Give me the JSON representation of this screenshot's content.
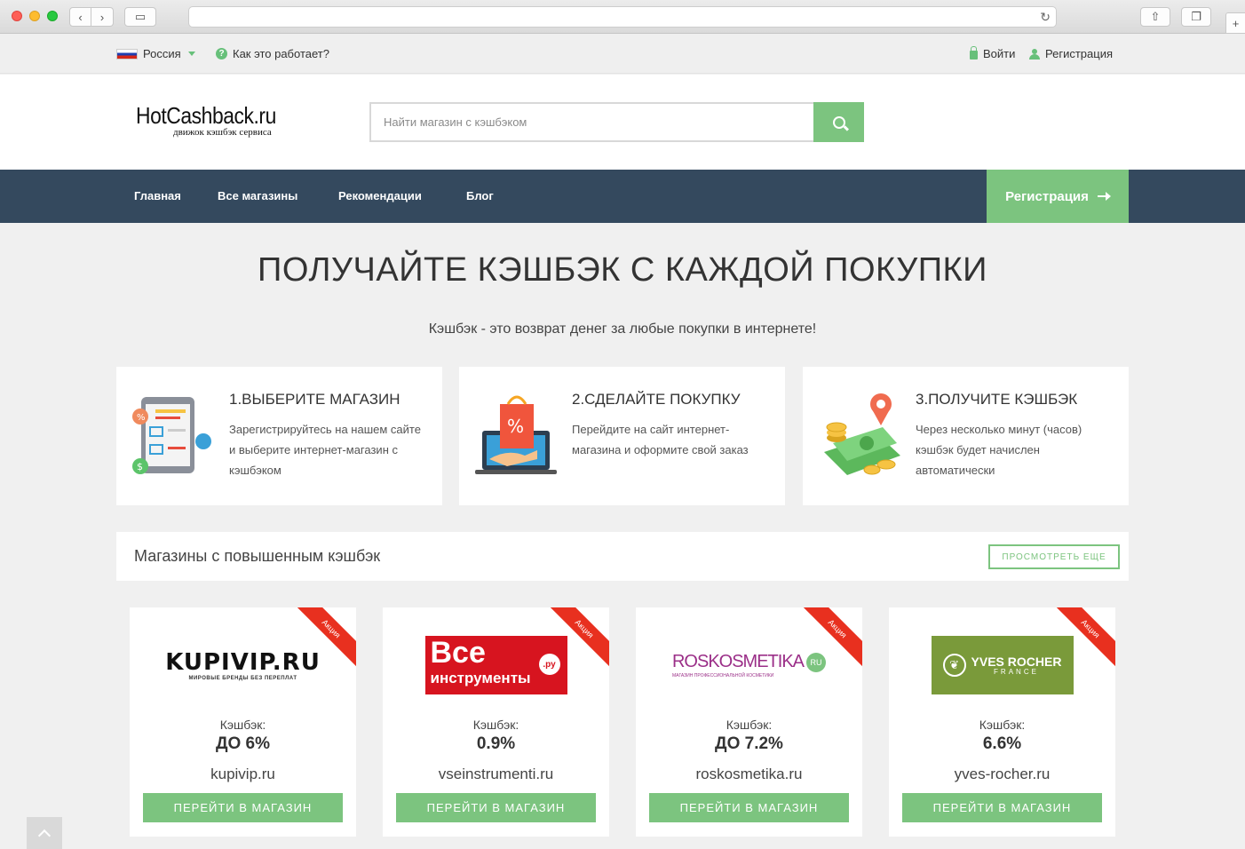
{
  "topbar": {
    "country": "Россия",
    "how_it_works": "Как это работает?",
    "login": "Войти",
    "register": "Регистрация"
  },
  "header": {
    "logo_main": "HotCashback.ru",
    "logo_sub": "движок кэшбэк сервиса",
    "search_placeholder": "Найти магазин с кэшбэком"
  },
  "nav": {
    "items": [
      "Главная",
      "Все магазины",
      "Рекомендации",
      "Блог"
    ],
    "register": "Регистрация"
  },
  "hero": {
    "title": "ПОЛУЧАЙТЕ КЭШБЭК С КАЖДОЙ ПОКУПКИ",
    "subtitle": "Кэшбэк - это возврат денег за любые покупки в интернете!"
  },
  "steps": [
    {
      "title": "1.ВЫБЕРИТЕ МАГАЗИН",
      "text": "Зарегистрируйтесь на нашем сайте и выберите интернет-магазин с кэшбэком"
    },
    {
      "title": "2.СДЕЛАЙТЕ ПОКУПКУ",
      "text": "Перейдите на сайт интернет-магазина и оформите свой заказ"
    },
    {
      "title": "3.ПОЛУЧИТЕ КЭШБЭК",
      "text": "Через несколько минут (часов) кэшбэк будет начислен автоматически"
    }
  ],
  "promo": {
    "title": "Магазины с повышенным кэшбэк",
    "more": "ПРОСМОТРЕТЬ ЕЩЕ"
  },
  "stores": [
    {
      "ribbon": "Акция",
      "logo_text": "KUPIVIP.RU",
      "logo_tagline": "МИРОВЫЕ БРЕНДЫ БЕЗ ПЕРЕПЛАТ",
      "cashback_label": "Кэшбэк:",
      "cashback": "ДО 6%",
      "domain": "kupivip.ru",
      "button": "ПЕРЕЙТИ В МАГАЗИН"
    },
    {
      "ribbon": "Акция",
      "logo_text": "Все",
      "logo_text2": "инструменты",
      "logo_badge": ".ру",
      "cashback_label": "Кэшбэк:",
      "cashback": "0.9%",
      "domain": "vseinstrumenti.ru",
      "button": "ПЕРЕЙТИ В МАГАЗИН"
    },
    {
      "ribbon": "Акция",
      "logo_text": "ROSKOSMETIKA",
      "logo_badge": "RU",
      "logo_tagline": "МАГАЗИН ПРОФЕССИОНАЛЬНОЙ КОСМЕТИКИ",
      "cashback_label": "Кэшбэк:",
      "cashback": "ДО 7.2%",
      "domain": "roskosmetika.ru",
      "button": "ПЕРЕЙТИ В МАГАЗИН"
    },
    {
      "ribbon": "Акция",
      "logo_text": "YVES ROCHER",
      "logo_tagline": "FRANCE",
      "cashback_label": "Кэшбэк:",
      "cashback": "6.6%",
      "domain": "yves-rocher.ru",
      "button": "ПЕРЕЙТИ В МАГАЗИН"
    }
  ],
  "colors": {
    "accent": "#7cc47f",
    "nav_bg": "#34495e",
    "ribbon": "#e8301f"
  }
}
